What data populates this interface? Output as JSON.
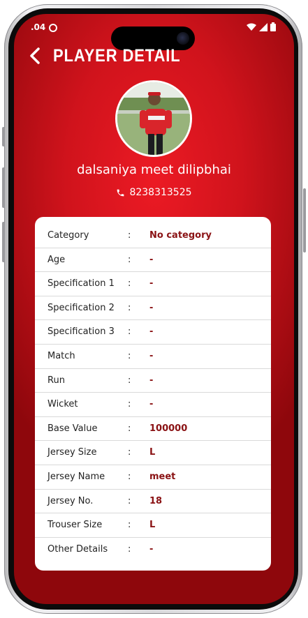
{
  "status_bar": {
    "time": ".04"
  },
  "header": {
    "title": "PLAYER DETAIL"
  },
  "player": {
    "name": "dalsaniya meet dilipbhai",
    "phone": "8238313525"
  },
  "details": [
    {
      "label": "Category",
      "colon": ":",
      "value": "No category"
    },
    {
      "label": "Age",
      "colon": ":",
      "value": "-"
    },
    {
      "label": "Specification 1",
      "colon": ":",
      "value": "-"
    },
    {
      "label": "Specification 2",
      "colon": ":",
      "value": "-"
    },
    {
      "label": "Specification 3",
      "colon": ":",
      "value": "-"
    },
    {
      "label": "Match",
      "colon": ":",
      "value": "-"
    },
    {
      "label": "Run",
      "colon": ":",
      "value": "-"
    },
    {
      "label": "Wicket",
      "colon": ":",
      "value": "-"
    },
    {
      "label": "Base Value",
      "colon": ":",
      "value": "100000"
    },
    {
      "label": "Jersey Size",
      "colon": ":",
      "value": "L"
    },
    {
      "label": "Jersey Name",
      "colon": ":",
      "value": "meet"
    },
    {
      "label": "Jersey No.",
      "colon": ":",
      "value": "18"
    },
    {
      "label": "Trouser Size",
      "colon": ":",
      "value": "L"
    },
    {
      "label": "Other Details",
      "colon": ":",
      "value": "-"
    }
  ],
  "colors": {
    "primary": "#d0131c",
    "value_text": "#8a1214"
  }
}
